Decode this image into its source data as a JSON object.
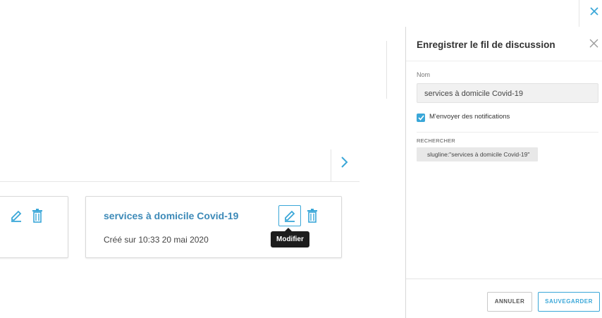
{
  "cards": [
    {
      "title": "",
      "date": ""
    },
    {
      "title": "services à domicile Covid-19",
      "date": "Créé sur 10:33 20 mai 2020"
    }
  ],
  "tooltip": "Modifier",
  "panel": {
    "title": "Enregistrer le fil de discussion",
    "name_label": "Nom",
    "name_value": "services à domicile Covid-19",
    "notify_label": "M'envoyer des notifications",
    "notify_checked": true,
    "search_label": "RECHERCHER",
    "search_chip": "slugline:\"services à domicile Covid-19\"",
    "cancel_label": "ANNULER",
    "save_label": "SAUVEGARDER"
  },
  "colors": {
    "accent": "#3aa7d8",
    "title_link": "#3d8ab8"
  },
  "icons": [
    "edit-icon",
    "trash-icon",
    "close-icon",
    "chevron-right-icon",
    "check-icon"
  ]
}
